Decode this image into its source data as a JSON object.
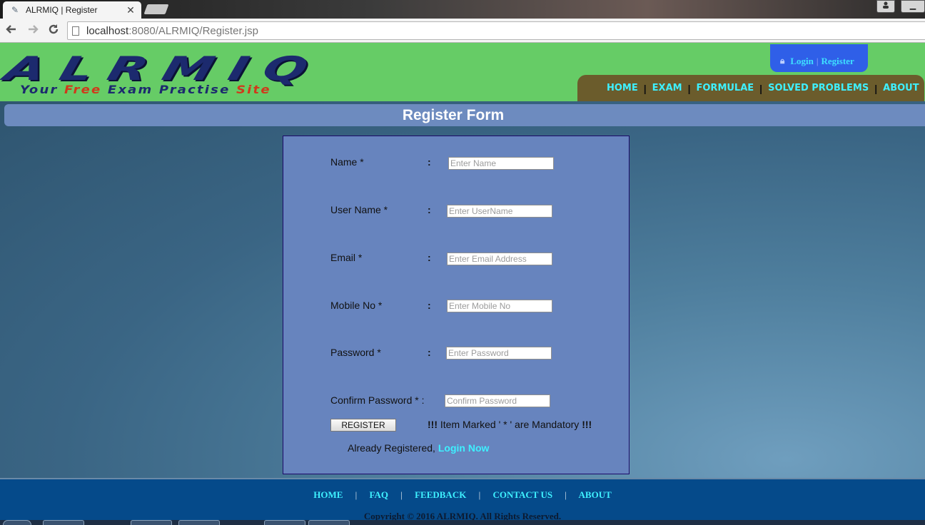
{
  "browser": {
    "tab_title": "ALRMIQ | Register",
    "tab_close": "✕",
    "url_host": "localhost",
    "url_rest": ":8080/ALRMIQ/Register.jsp",
    "back_icon": "back-arrow-icon",
    "forward_icon": "forward-arrow-icon",
    "reload_icon": "reload-icon"
  },
  "header": {
    "logo_text": "ALRMIQ",
    "tagline": {
      "your": "Your",
      "free": "Free",
      "exam": "Exam",
      "practise": "Practise",
      "site": "Site"
    },
    "auth": {
      "login": "Login",
      "sep": "|",
      "register": "Register"
    },
    "nav": [
      {
        "label": "HOME"
      },
      {
        "label": "EXAM"
      },
      {
        "label": "FORMULAE"
      },
      {
        "label": "SOLVED PROBLEMS"
      },
      {
        "label": "ABOUT"
      }
    ],
    "nav_sep": "|",
    "colors": {
      "header_bg": "#66cc66",
      "nav_bg": "#6b5c2c",
      "link": "#3ef0ff",
      "auth_bg": "#2f5fe8"
    }
  },
  "form": {
    "title": "Register Form",
    "fields": [
      {
        "label": "Name  *",
        "colon": ":",
        "placeholder": "Enter Name"
      },
      {
        "label": "User Name *",
        "colon": ":",
        "placeholder": "Enter UserName"
      },
      {
        "label": "Email  *",
        "colon": ":",
        "placeholder": "Enter Email Address"
      },
      {
        "label": "Mobile No  *",
        "colon": ":",
        "placeholder": "Enter Mobile No"
      },
      {
        "label": "Password  *",
        "colon": ":",
        "placeholder": "Enter Password"
      },
      {
        "label": "Confirm Password  * :",
        "colon": "",
        "placeholder": "Confirm Password"
      }
    ],
    "register_button": "REGISTER",
    "mandatory_prefix": "!!!",
    "mandatory_text": " Item Marked ' * ' are Mandatory ",
    "mandatory_suffix": "!!!",
    "already_text": "Already Registered, ",
    "login_now": "Login Now"
  },
  "footer": {
    "links": [
      {
        "label": "HOME"
      },
      {
        "label": "FAQ"
      },
      {
        "label": "FEEDBACK"
      },
      {
        "label": "CONTACT US"
      },
      {
        "label": "ABOUT"
      }
    ],
    "sep": "|",
    "copyright": "Copyright © 2016 ALRMIQ. All Rights Reserved."
  }
}
